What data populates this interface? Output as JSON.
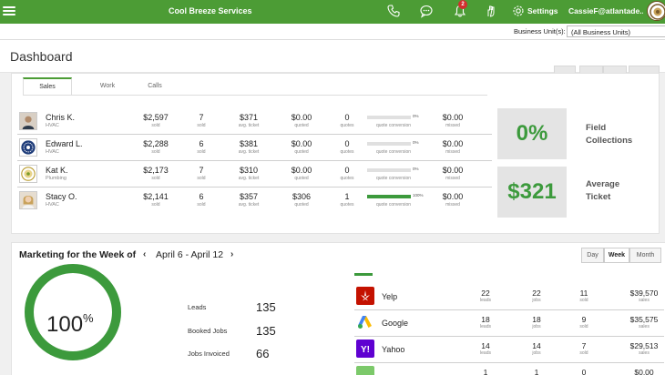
{
  "app": {
    "title": "Cool Breeze Services",
    "settings_label": "Settings",
    "user_label": "CassieF@atlantade...",
    "notification_count": "2",
    "brand_color": "#4c9c35"
  },
  "business_unit": {
    "label": "Business Unit(s):",
    "value": "(All Business Units)"
  },
  "page": {
    "title": "Dashboard"
  },
  "sales_tabs": [
    {
      "label": "Sales",
      "active": true
    },
    {
      "label": "Work",
      "active": false
    },
    {
      "label": "Calls",
      "active": false
    }
  ],
  "metric_labels": {
    "sold": "sold",
    "avg_ticket": "avg. ticket",
    "quoted": "quoted",
    "quotes": "quotes",
    "quote_conversion": "quote conversion",
    "missed": "missed"
  },
  "technicians": [
    {
      "name": "Chris K.",
      "trade": "HVAC",
      "sold_amount": "$2,597",
      "sold_count": "7",
      "avg_ticket": "$371",
      "quoted": "$0.00",
      "quotes": "0",
      "conversion": 0,
      "conversion_label": "0%",
      "missed": "$0.00"
    },
    {
      "name": "Edward L.",
      "trade": "HVAC",
      "sold_amount": "$2,288",
      "sold_count": "6",
      "avg_ticket": "$381",
      "quoted": "$0.00",
      "quotes": "0",
      "conversion": 0,
      "conversion_label": "0%",
      "missed": "$0.00"
    },
    {
      "name": "Kat K.",
      "trade": "Plumbing",
      "sold_amount": "$2,173",
      "sold_count": "7",
      "avg_ticket": "$310",
      "quoted": "$0.00",
      "quotes": "0",
      "conversion": 0,
      "conversion_label": "0%",
      "missed": "$0.00"
    },
    {
      "name": "Stacy O.",
      "trade": "HVAC",
      "sold_amount": "$2,141",
      "sold_count": "6",
      "avg_ticket": "$357",
      "quoted": "$306",
      "quotes": "1",
      "conversion": 100,
      "conversion_label": "100%",
      "missed": "$0.00"
    }
  ],
  "kpis": [
    {
      "value": "0%",
      "label_line1": "Field",
      "label_line2": "Collections"
    },
    {
      "value": "$321",
      "label_line1": "Average",
      "label_line2": "Ticket"
    }
  ],
  "marketing": {
    "title": "Marketing for the Week of",
    "prev_icon": "chevron-left-icon",
    "next_icon": "chevron-right-icon",
    "date_range": "April 6 - April 12",
    "periods": [
      {
        "label": "Day",
        "active": false
      },
      {
        "label": "Week",
        "active": true
      },
      {
        "label": "Month",
        "active": false
      }
    ],
    "ring_value": "100",
    "ring_unit": "%",
    "ring_fraction": 1.0,
    "stats": [
      {
        "label": "Leads",
        "value": "135"
      },
      {
        "label": "Booked Jobs",
        "value": "135"
      },
      {
        "label": "Jobs Invoiced",
        "value": "66"
      }
    ],
    "source_labels": {
      "leads": "leads",
      "jobs": "jobs",
      "sold": "sold",
      "sales": "sales"
    },
    "sources": [
      {
        "name": "Yelp",
        "icon": "yelp-icon",
        "leads": "22",
        "jobs": "22",
        "sold": "11",
        "sales": "$39,570"
      },
      {
        "name": "Google",
        "icon": "google-ads-icon",
        "leads": "18",
        "jobs": "18",
        "sold": "9",
        "sales": "$35,575"
      },
      {
        "name": "Yahoo",
        "icon": "yahoo-icon",
        "leads": "14",
        "jobs": "14",
        "sold": "7",
        "sales": "$29,513"
      },
      {
        "name": "",
        "icon": "generic-source-icon",
        "leads": "1",
        "jobs": "1",
        "sold": "0",
        "sales": "$0.00"
      }
    ]
  }
}
